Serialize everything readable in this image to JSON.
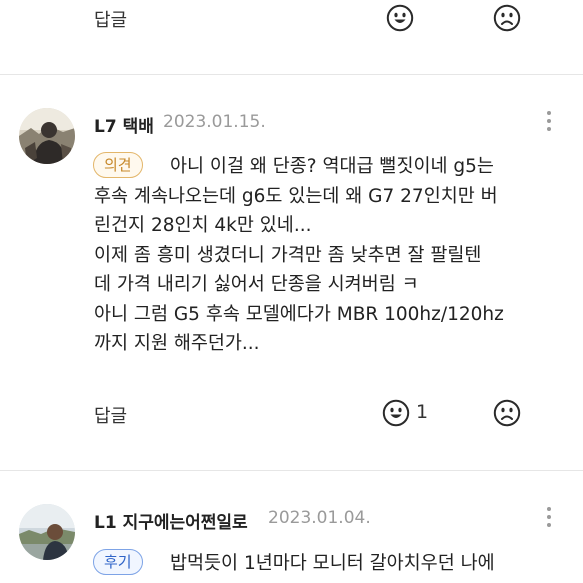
{
  "top_actions": {
    "reply_label": "답글"
  },
  "comment1": {
    "username": "L7 택배",
    "date": "2023.01.15.",
    "badge": "의견",
    "lines": [
      "아니 이걸 왜 단종? 역대급 뻘짓이네 g5는",
      "후속 계속나오는데 g6도 있는데 왜 G7 27인치만 버",
      "린건지 28인치 4k만 있네...",
      "이제 좀 흥미 생겼더니 가격만 좀 낮추면 잘 팔릴텐",
      "데 가격 내리기 싫어서 단종을 시켜버림 ㅋ",
      "아니 그럼 G5 후속 모델에다가 MBR 100hz/120hz",
      "까지 지원 해주던가..."
    ],
    "reply_label": "답글",
    "like_count": "1"
  },
  "comment2": {
    "username": "L1 지구에는어쩐일로",
    "date": "2023.01.04.",
    "badge": "후기",
    "lines": [
      "밥먹듯이 1년마다 모니터 갈아치우던 나에"
    ]
  },
  "colors": {
    "badge_opinion": "#c7892b",
    "badge_review": "#2f64c8",
    "divider": "#e6e6e6",
    "meta_gray": "#9a9a9a"
  },
  "icons": [
    "smile-face-icon",
    "frown-face-icon",
    "more-vertical-icon"
  ]
}
